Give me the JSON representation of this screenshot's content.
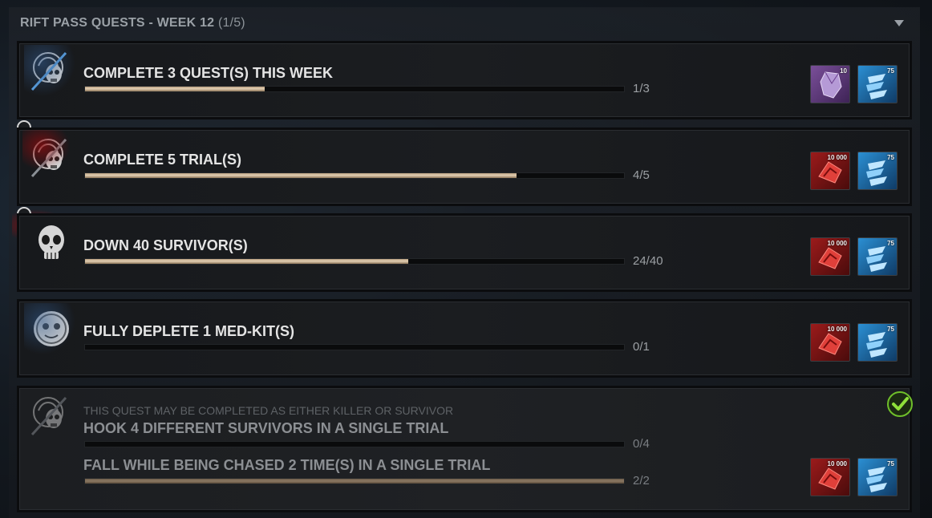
{
  "header": {
    "title": "RIFT PASS QUESTS - WEEK 12",
    "count": "(1/5)"
  },
  "quests": [
    {
      "title": "COMPLETE 3 QUEST(S) THIS WEEK",
      "progress_text": "1/3",
      "progress": 0.333,
      "emblem": "killer-survivor-split-icon",
      "rewards": [
        {
          "type": "rift-fragment",
          "amount": "10"
        },
        {
          "type": "iridescent-shards",
          "amount": "75"
        }
      ]
    },
    {
      "title": "COMPLETE 5 TRIAL(S)",
      "progress_text": "4/5",
      "progress": 0.8,
      "emblem": "killer-survivor-split-icon",
      "rewards": [
        {
          "type": "bloodpoints",
          "amount": "10 000"
        },
        {
          "type": "iridescent-shards",
          "amount": "75"
        }
      ]
    },
    {
      "title": "DOWN 40 SURVIVOR(S)",
      "progress_text": "24/40",
      "progress": 0.6,
      "emblem": "killer-skull-icon",
      "rewards": [
        {
          "type": "bloodpoints",
          "amount": "10 000"
        },
        {
          "type": "iridescent-shards",
          "amount": "75"
        }
      ]
    },
    {
      "title": "FULLY DEPLETE 1 MED-KIT(S)",
      "progress_text": "0/1",
      "progress": 0.0,
      "emblem": "survivor-face-icon",
      "rewards": [
        {
          "type": "bloodpoints",
          "amount": "10 000"
        },
        {
          "type": "iridescent-shards",
          "amount": "75"
        }
      ]
    },
    {
      "note": "THIS QUEST MAY BE COMPLETED AS EITHER KILLER OR SURVIVOR",
      "title": "HOOK 4 DIFFERENT SURVIVORS IN A SINGLE TRIAL",
      "progress_text": "0/4",
      "progress": 0.0,
      "title2": "FALL WHILE BEING CHASED 2 TIME(S) IN A SINGLE TRIAL",
      "progress2_text": "2/2",
      "progress2": 1.0,
      "emblem": "killer-survivor-split-icon",
      "completed": true,
      "rewards": [
        {
          "type": "bloodpoints",
          "amount": "10 000"
        },
        {
          "type": "iridescent-shards",
          "amount": "75"
        }
      ]
    }
  ],
  "colors": {
    "accent_blood": "#9b1b1b",
    "accent_shards": "#2b8fd3",
    "complete_green": "#6fbf2a"
  }
}
